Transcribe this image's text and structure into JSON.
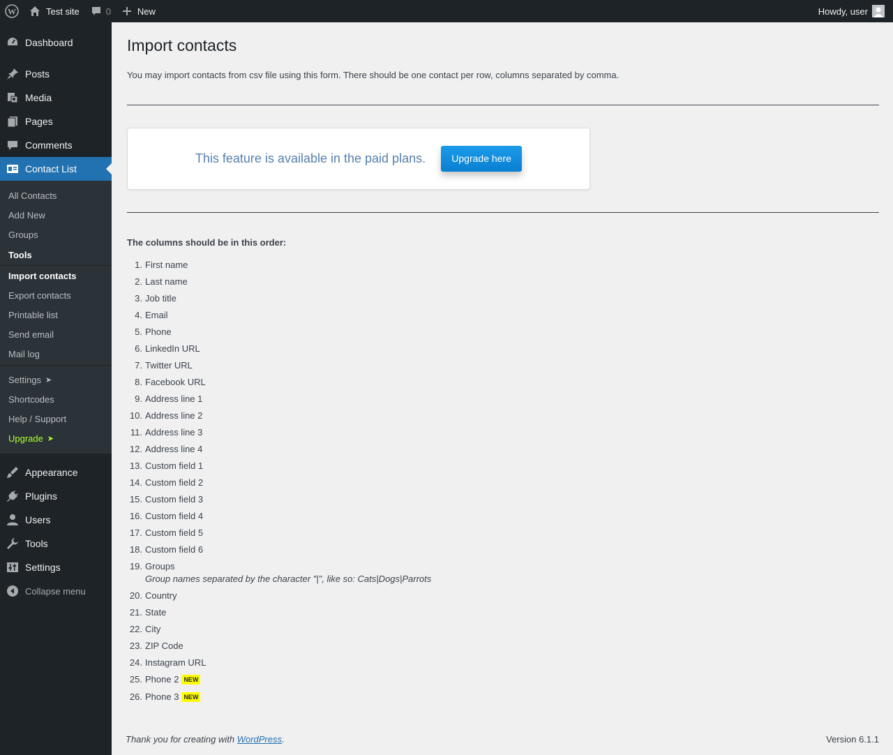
{
  "admin_bar": {
    "site_name": "Test site",
    "comments_count": "0",
    "new_label": "New",
    "howdy": "Howdy, user"
  },
  "sidebar": {
    "items": [
      {
        "label": "Dashboard",
        "icon": "dashboard-icon"
      },
      {
        "label": "Posts",
        "icon": "pin-icon"
      },
      {
        "label": "Media",
        "icon": "media-icon"
      },
      {
        "label": "Pages",
        "icon": "pages-icon"
      },
      {
        "label": "Comments",
        "icon": "comment-icon"
      },
      {
        "label": "Contact List",
        "icon": "id-card-icon"
      }
    ],
    "submenu": {
      "all_contacts": "All Contacts",
      "add_new": "Add New",
      "groups": "Groups",
      "tools": "Tools",
      "import_contacts": "Import contacts",
      "export_contacts": "Export contacts",
      "printable_list": "Printable list",
      "send_email": "Send email",
      "mail_log": "Mail log",
      "settings": "Settings",
      "shortcodes": "Shortcodes",
      "help_support": "Help / Support",
      "upgrade": "Upgrade",
      "arrow": "➤"
    },
    "lower_items": [
      {
        "label": "Appearance",
        "icon": "brush-icon"
      },
      {
        "label": "Plugins",
        "icon": "plug-icon"
      },
      {
        "label": "Users",
        "icon": "user-icon"
      },
      {
        "label": "Tools",
        "icon": "wrench-icon"
      },
      {
        "label": "Settings",
        "icon": "sliders-icon"
      }
    ],
    "collapse": "Collapse menu"
  },
  "main": {
    "title": "Import contacts",
    "intro": "You may import contacts from csv file using this form. There should be one contact per row, columns separated by comma.",
    "card_message": "This feature is available in the paid plans.",
    "upgrade_button": "Upgrade here",
    "columns_title": "The columns should be in this order:",
    "columns": [
      "First name",
      "Last name",
      "Job title",
      "Email",
      "Phone",
      "LinkedIn URL",
      "Twitter URL",
      "Facebook URL",
      "Address line 1",
      "Address line 2",
      "Address line 3",
      "Address line 4",
      "Custom field 1",
      "Custom field 2",
      "Custom field 3",
      "Custom field 4",
      "Custom field 5",
      "Custom field 6",
      "Groups",
      "Country",
      "State",
      "City",
      "ZIP Code",
      "Instagram URL",
      "Phone 2",
      "Phone 3"
    ],
    "groups_hint": "Group names separated by the character \"|\", like so: Cats|Dogs|Parrots",
    "new_badge": "NEW"
  },
  "footer": {
    "thanks_prefix": "Thank you for creating with ",
    "wordpress_link": "WordPress",
    "thanks_suffix": ".",
    "version": "Version 6.1.1"
  }
}
